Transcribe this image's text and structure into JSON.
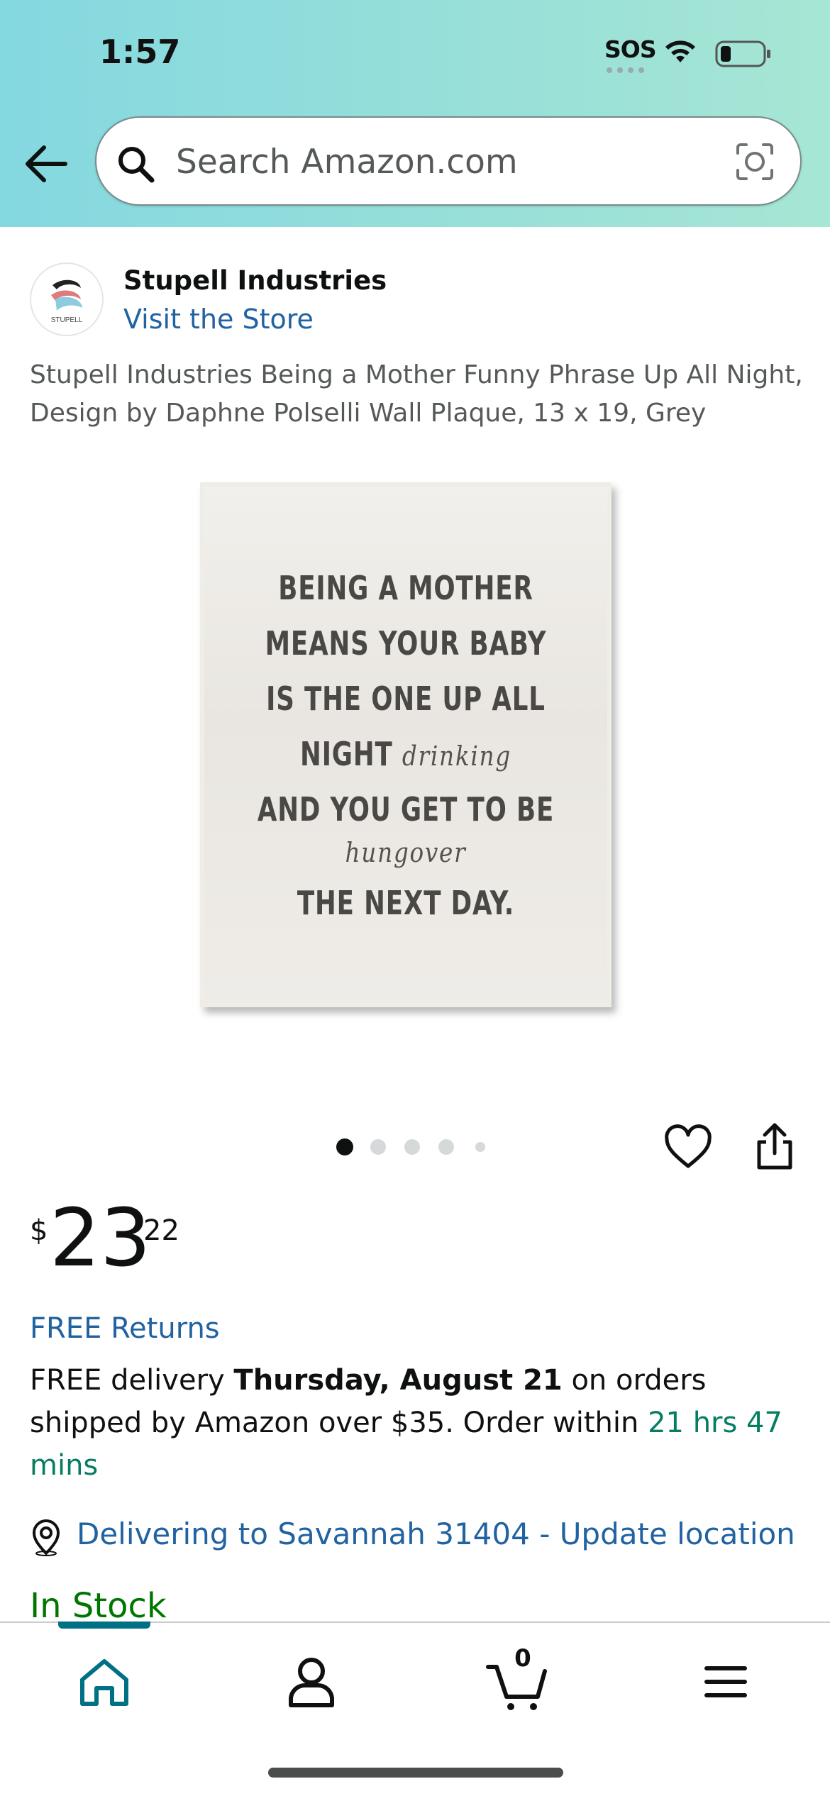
{
  "status_bar": {
    "time": "1:57",
    "sos": "SOS",
    "icons": [
      "wifi-icon",
      "battery-icon"
    ]
  },
  "header": {
    "back_icon": "arrow-left-icon",
    "search_placeholder": "Search Amazon.com",
    "search_icon": "search-icon",
    "camera_icon": "camera-lens-icon"
  },
  "store": {
    "name": "Stupell Industries",
    "link": "Visit the Store",
    "logo_text": "STUPELL"
  },
  "product": {
    "title": "Stupell Industries Being a Mother Funny Phrase Up All Night, Design by Daphne Polselli Wall Plaque, 13 x 19, Grey",
    "image_lines": [
      "BEING A MOTHER",
      "MEANS YOUR BABY",
      "IS THE ONE UP ALL",
      "NIGHT",
      "drinking",
      "AND YOU GET TO BE",
      "hungover",
      "THE NEXT DAY."
    ],
    "image_count": 5,
    "active_image_index": 0
  },
  "price": {
    "symbol": "$",
    "whole": "23",
    "fraction": "22"
  },
  "returns": "FREE Returns",
  "delivery": {
    "prefix": "FREE delivery ",
    "date": "Thursday, August 21",
    "middle": " on orders shipped by Amazon over $35. Order within ",
    "countdown": "21 hrs 47 mins"
  },
  "location": {
    "text": "Delivering to Savannah 31404 - Update location",
    "icon": "location-pin-icon"
  },
  "stock": "In Stock",
  "bottom_nav": {
    "items": [
      "home-icon",
      "account-icon",
      "cart-icon",
      "menu-icon"
    ],
    "cart_count": "0",
    "active": "home",
    "accent": "#007185"
  },
  "colors": {
    "link": "#2162a1",
    "countdown": "#067d62",
    "stock": "#007600",
    "header_gradient": [
      "#84d8e0",
      "#a6e6d4"
    ]
  }
}
